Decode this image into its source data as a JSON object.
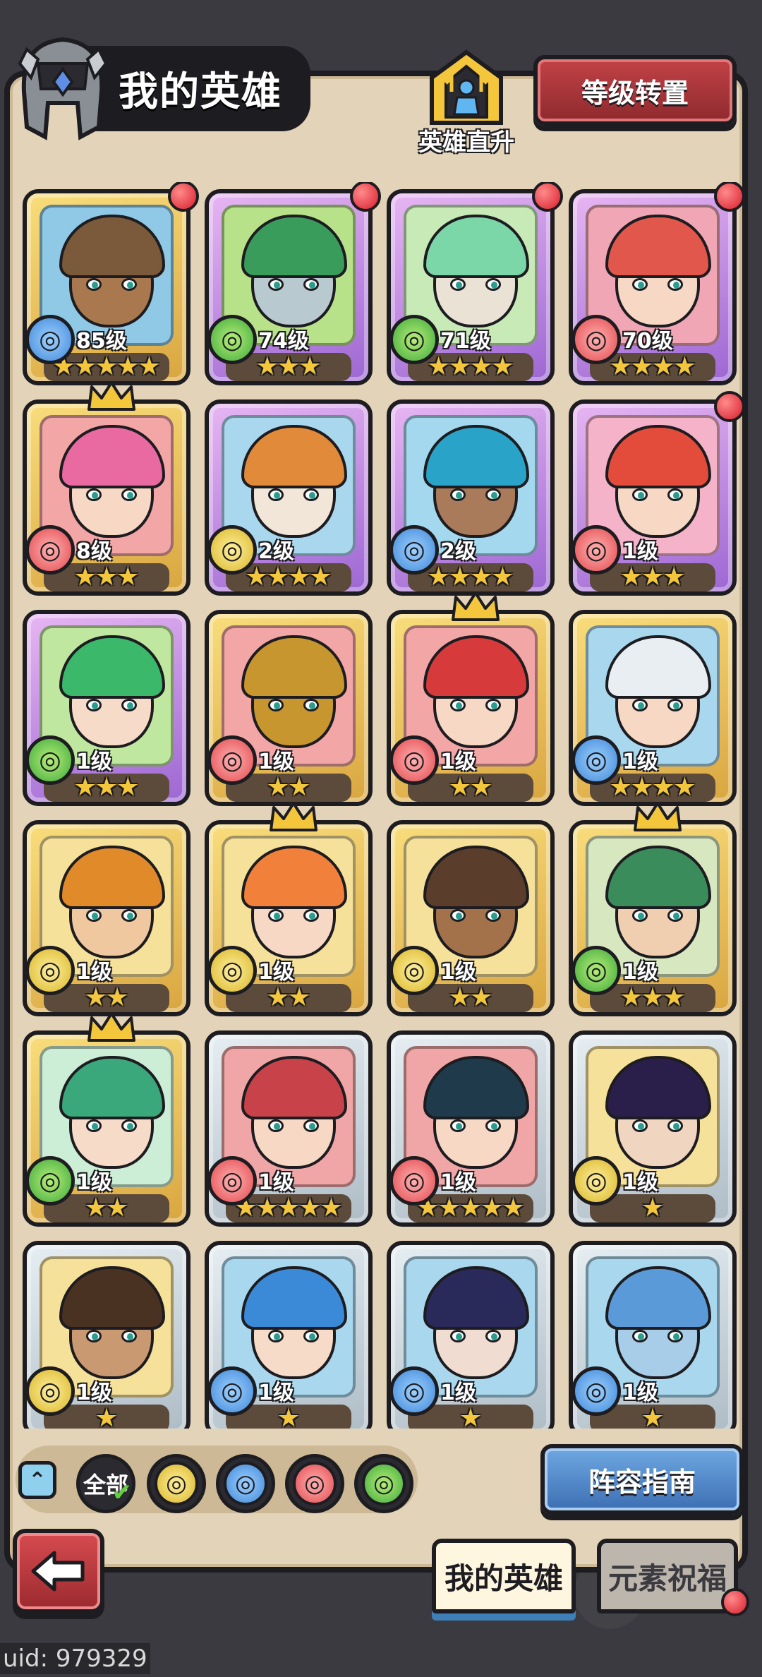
{
  "header": {
    "title": "我的英雄",
    "direct_upgrade_label": "英雄直升",
    "level_transfer_label": "等级转置"
  },
  "heroes": [
    {
      "level": "85级",
      "stars": 5,
      "element": "water",
      "rarity": "gold",
      "red_dot": true,
      "crown": false,
      "bg": "#8fc9e6",
      "hair": "#7a5a3a",
      "skin": "#a9784f"
    },
    {
      "level": "74级",
      "stars": 3,
      "element": "wood",
      "rarity": "purple",
      "red_dot": true,
      "crown": false,
      "bg": "#b8e28a",
      "hair": "#3a9c5a",
      "skin": "#b8c9d0"
    },
    {
      "level": "71级",
      "stars": 4,
      "element": "wood",
      "rarity": "purple",
      "red_dot": true,
      "crown": false,
      "bg": "#c7eab7",
      "hair": "#7cd7a8",
      "skin": "#e9e2d5"
    },
    {
      "level": "70级",
      "stars": 4,
      "element": "fire",
      "rarity": "purple",
      "red_dot": true,
      "crown": false,
      "bg": "#f0a6b4",
      "hair": "#e2574c",
      "skin": "#f6d8c4"
    },
    {
      "level": "8级",
      "stars": 3,
      "element": "fire",
      "rarity": "gold",
      "red_dot": false,
      "crown": true,
      "bg": "#f3a6a6",
      "hair": "#e86aa0",
      "skin": "#f6d8c4"
    },
    {
      "level": "2级",
      "stars": 4,
      "element": "earth",
      "rarity": "purple",
      "red_dot": false,
      "crown": false,
      "bg": "#a9d7ee",
      "hair": "#e08a3a",
      "skin": "#f1e6d8"
    },
    {
      "level": "2级",
      "stars": 4,
      "element": "water",
      "rarity": "purple",
      "red_dot": false,
      "crown": false,
      "bg": "#a4d8ee",
      "hair": "#2aa3c9",
      "skin": "#a97b5a"
    },
    {
      "level": "1级",
      "stars": 3,
      "element": "fire",
      "rarity": "purple",
      "red_dot": true,
      "crown": false,
      "bg": "#f4b3c8",
      "hair": "#e34b3b",
      "skin": "#f6d8c4"
    },
    {
      "level": "1级",
      "stars": 3,
      "element": "wood",
      "rarity": "purple",
      "red_dot": false,
      "crown": false,
      "bg": "#bfe7a0",
      "hair": "#3cb86a",
      "skin": "#f6dcc8"
    },
    {
      "level": "1级",
      "stars": 2,
      "element": "fire",
      "rarity": "gold",
      "red_dot": false,
      "crown": false,
      "bg": "#f3a6a6",
      "hair": "#c8962e",
      "skin": "#c8962e"
    },
    {
      "level": "1级",
      "stars": 2,
      "element": "fire",
      "rarity": "gold",
      "red_dot": false,
      "crown": true,
      "bg": "#f3a6a6",
      "hair": "#d63a3a",
      "skin": "#f6d8c4"
    },
    {
      "level": "1级",
      "stars": 4,
      "element": "water",
      "rarity": "gold",
      "red_dot": false,
      "crown": false,
      "bg": "#a9d7ee",
      "hair": "#e9eef2",
      "skin": "#f6d8c4"
    },
    {
      "level": "1级",
      "stars": 2,
      "element": "earth",
      "rarity": "gold",
      "red_dot": false,
      "crown": false,
      "bg": "#f6e19a",
      "hair": "#e08a2a",
      "skin": "#f0c8a0"
    },
    {
      "level": "1级",
      "stars": 2,
      "element": "earth",
      "rarity": "gold",
      "red_dot": false,
      "crown": true,
      "bg": "#f6e19a",
      "hair": "#f0803a",
      "skin": "#f6d8c4"
    },
    {
      "level": "1级",
      "stars": 2,
      "element": "earth",
      "rarity": "gold",
      "red_dot": false,
      "crown": false,
      "bg": "#f6e19a",
      "hair": "#5a3d2a",
      "skin": "#a3714a"
    },
    {
      "level": "1级",
      "stars": 3,
      "element": "wood",
      "rarity": "gold",
      "red_dot": false,
      "crown": true,
      "bg": "#d7e7c0",
      "hair": "#3a8c5a",
      "skin": "#f0cfb0"
    },
    {
      "level": "1级",
      "stars": 2,
      "element": "wood",
      "rarity": "gold",
      "red_dot": false,
      "crown": true,
      "bg": "#cdeed6",
      "hair": "#3aa87a",
      "skin": "#f6dcc8"
    },
    {
      "level": "1级",
      "stars": 5,
      "element": "fire",
      "rarity": "silver",
      "red_dot": false,
      "crown": false,
      "bg": "#f0a6a6",
      "hair": "#c8424a",
      "skin": "#f6d8c4"
    },
    {
      "level": "1级",
      "stars": 5,
      "element": "fire",
      "rarity": "silver",
      "red_dot": false,
      "crown": false,
      "bg": "#f0a6a6",
      "hair": "#1f3a4a",
      "skin": "#f6d8c4"
    },
    {
      "level": "1级",
      "stars": 1,
      "element": "earth",
      "rarity": "silver",
      "red_dot": false,
      "crown": false,
      "bg": "#f6e19a",
      "hair": "#2a1f4a",
      "skin": "#f0d6c0"
    },
    {
      "level": "1级",
      "stars": 1,
      "element": "earth",
      "rarity": "silver",
      "red_dot": false,
      "crown": false,
      "bg": "#f6e19a",
      "hair": "#4a3222",
      "skin": "#c99a72"
    },
    {
      "level": "1级",
      "stars": 1,
      "element": "water",
      "rarity": "silver",
      "red_dot": false,
      "crown": false,
      "bg": "#a9d7ee",
      "hair": "#3a8ad8",
      "skin": "#f6dcc8"
    },
    {
      "level": "1级",
      "stars": 1,
      "element": "water",
      "rarity": "silver",
      "red_dot": false,
      "crown": false,
      "bg": "#a9d7ee",
      "hair": "#2a2a5a",
      "skin": "#f0dcd0"
    },
    {
      "level": "1级",
      "stars": 1,
      "element": "water",
      "rarity": "silver",
      "red_dot": false,
      "crown": false,
      "bg": "#a9d7ee",
      "hair": "#5a9ad8",
      "skin": "#a8cde8"
    }
  ],
  "filters": {
    "all_label": "全部",
    "elements": [
      "earth",
      "water",
      "fire",
      "wood"
    ]
  },
  "buttons": {
    "team_guide": "阵容指南"
  },
  "tabs": {
    "my_heroes": "我的英雄",
    "element_blessing": "元素祝福"
  },
  "footer": {
    "uid": "uid: 979329"
  },
  "colors": {
    "water": "#3f87d8",
    "wood": "#3fa83a",
    "fire": "#e3484d",
    "earth": "#d9b626",
    "star": "#f3c63c",
    "notification": "#d81e2c"
  }
}
